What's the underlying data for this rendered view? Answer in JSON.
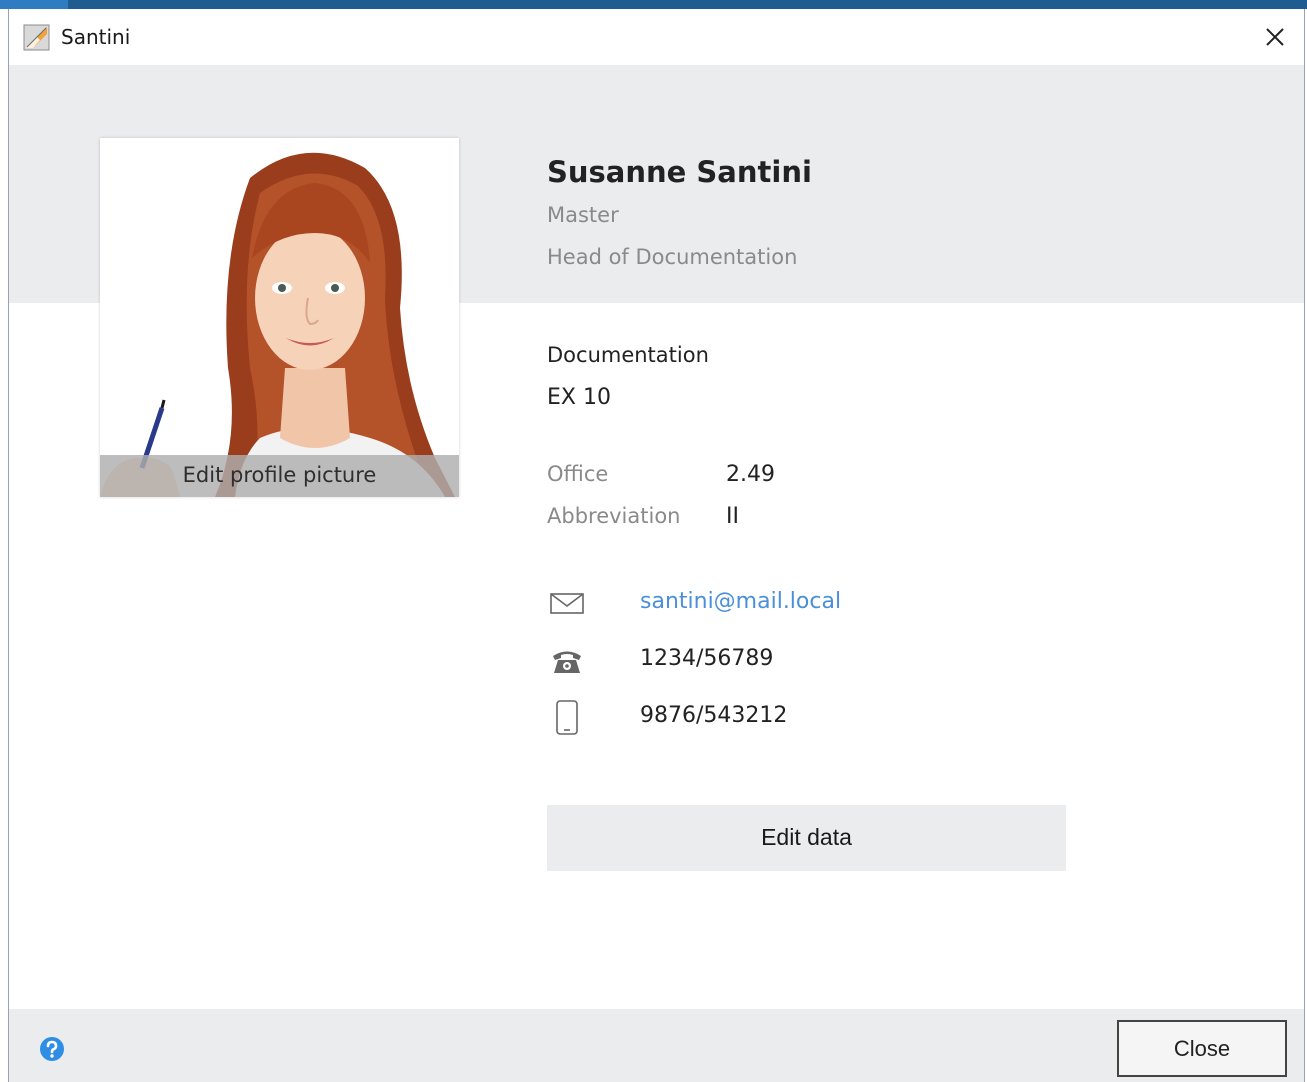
{
  "window": {
    "title": "Santini",
    "app_icon": "santini-app-icon",
    "close_icon": "close-icon"
  },
  "profile": {
    "photo_action": "Edit profile picture",
    "name": "Susanne Santini",
    "title": "Master",
    "position": "Head of Documentation",
    "department": "Documentation",
    "room": "EX 10",
    "details": [
      {
        "label": "Office",
        "value": "2.49"
      },
      {
        "label": "Abbreviation",
        "value": "II"
      }
    ],
    "contacts": {
      "email": "santini@mail.local",
      "phone": "1234/56789",
      "mobile": "9876/543212"
    },
    "edit_button": "Edit data"
  },
  "footer": {
    "help_icon": "help-icon",
    "close_button": "Close"
  },
  "colors": {
    "accent": "#1f5c8f",
    "band": "#ebecee",
    "link": "#4a90d9",
    "help": "#2f8de4"
  }
}
